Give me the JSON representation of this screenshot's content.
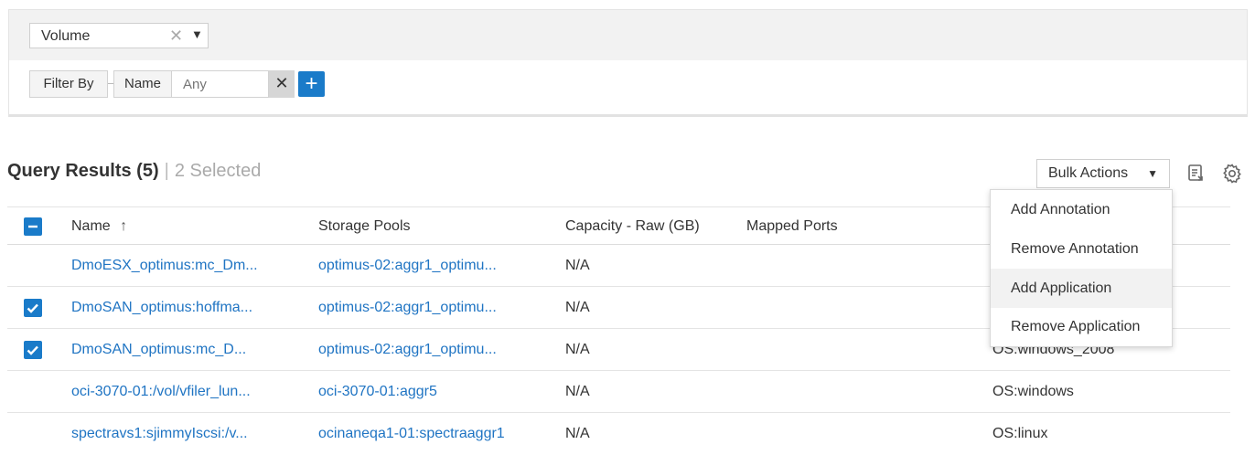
{
  "filter": {
    "type_value": "Volume",
    "filter_by_label": "Filter By",
    "field_label": "Name",
    "value_placeholder": "Any"
  },
  "results": {
    "title": "Query Results (5)",
    "separator": "|",
    "selected": "2 Selected"
  },
  "bulk_actions": {
    "label": "Bulk Actions",
    "menu": [
      {
        "label": "Add Annotation"
      },
      {
        "label": "Remove Annotation"
      },
      {
        "label": "Add Application"
      },
      {
        "label": "Remove Application"
      }
    ],
    "hovered_index": 2
  },
  "table": {
    "columns": {
      "name": "Name",
      "sort_indicator": "↑",
      "storage_pools": "Storage Pools",
      "capacity": "Capacity - Raw (GB)",
      "mapped_ports": "Mapped Ports"
    },
    "rows": [
      {
        "checked": false,
        "name": "DmoESX_optimus:mc_Dm...",
        "pool": "optimus-02:aggr1_optimu...",
        "capacity": "N/A",
        "annotation": ""
      },
      {
        "checked": true,
        "name": "DmoSAN_optimus:hoffma...",
        "pool": "optimus-02:aggr1_optimu...",
        "capacity": "N/A",
        "annotation": ""
      },
      {
        "checked": true,
        "name": "DmoSAN_optimus:mc_D...",
        "pool": "optimus-02:aggr1_optimu...",
        "capacity": "N/A",
        "annotation": "OS:windows_2008"
      },
      {
        "checked": false,
        "name": "oci-3070-01:/vol/vfiler_lun...",
        "pool": "oci-3070-01:aggr5",
        "capacity": "N/A",
        "annotation": "OS:windows"
      },
      {
        "checked": false,
        "name": "spectravs1:sjimmyIscsi:/v...",
        "pool": "ocinaneqa1-01:spectraaggr1",
        "capacity": "N/A",
        "annotation": "OS:linux"
      }
    ]
  },
  "colors": {
    "accent": "#1a7bc9",
    "link": "#1f74c3"
  }
}
